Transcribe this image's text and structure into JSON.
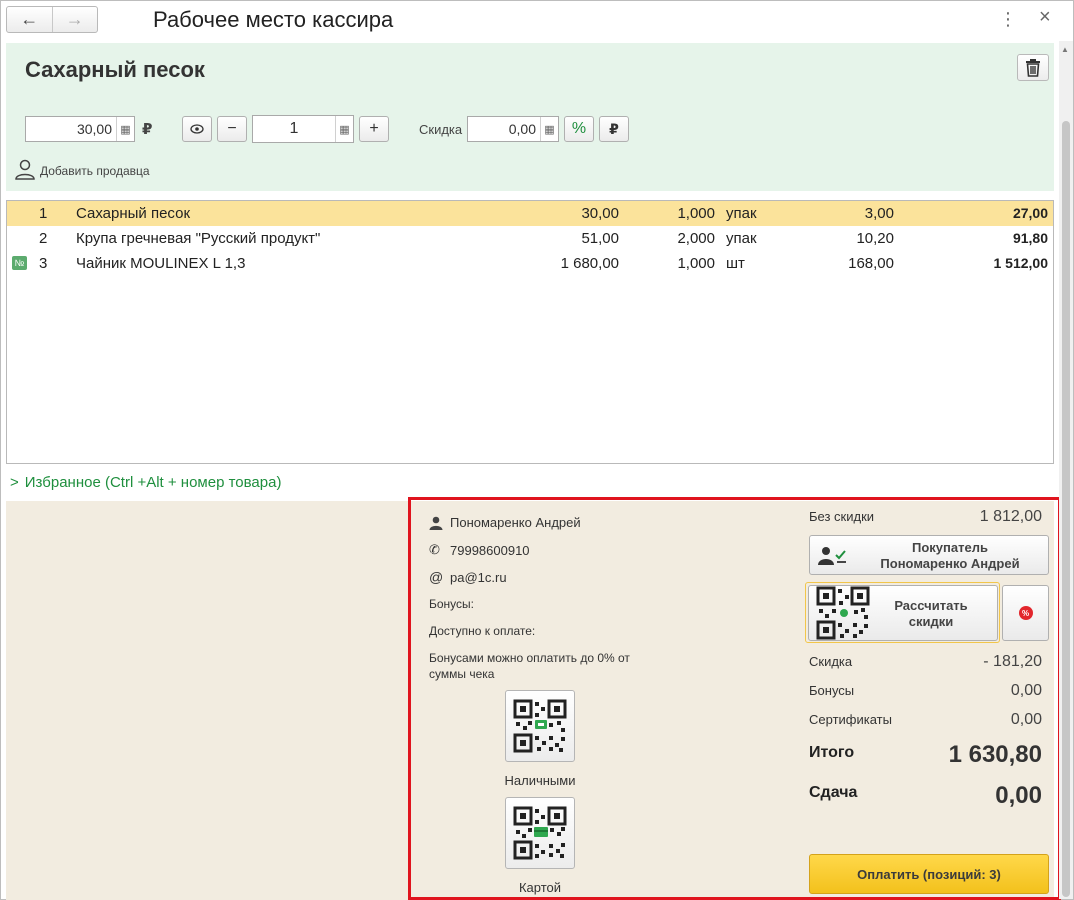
{
  "window": {
    "title": "Рабочее место кассира",
    "back_icon": "←",
    "forward_icon": "→",
    "more_icon": "⋮",
    "close_icon": "×"
  },
  "item": {
    "name": "Сахарный песок",
    "price": "30,00",
    "currency": "₽",
    "quantity": "1",
    "discount_label": "Скидка",
    "discount_value": "0,00",
    "percent_label": "%",
    "ruble_label": "₽",
    "add_seller": "Добавить продавца"
  },
  "table": {
    "rows": [
      {
        "n": "1",
        "name": "Сахарный песок",
        "price": "30,00",
        "qty": "1,000",
        "unit": "упак",
        "discount": "3,00",
        "sum": "27,00"
      },
      {
        "n": "2",
        "name": "Крупа гречневая \"Русский продукт\"",
        "price": "51,00",
        "qty": "2,000",
        "unit": "упак",
        "discount": "10,20",
        "sum": "91,80"
      },
      {
        "n": "3",
        "name": "Чайник MOULINEX L 1,3",
        "price": "1 680,00",
        "qty": "1,000",
        "unit": "шт",
        "discount": "168,00",
        "sum": "1 512,00",
        "marker": "№"
      }
    ]
  },
  "favorites": "Избранное (Ctrl +Alt + номер товара)",
  "customer": {
    "name": "Пономаренко Андрей",
    "phone": "79998600910",
    "email": "pa@1c.ru",
    "bonuses_label": "Бонусы:",
    "available_label": "Доступно к оплате:",
    "bonus_note": "Бонусами можно оплатить до 0% от суммы чека",
    "cash_label": "Наличными",
    "card_label": "Картой"
  },
  "summary": {
    "no_discount_label": "Без скидки",
    "no_discount_value": "1 812,00",
    "buyer_btn_line1": "Покупатель",
    "buyer_btn_line2": "Пономаренко Андрей",
    "calc_btn_line1": "Рассчитать",
    "calc_btn_line2": "скидки",
    "discount_label": "Скидка",
    "discount_value": "- 181,20",
    "bonuses_label": "Бонусы",
    "bonuses_value": "0,00",
    "certificates_label": "Сертификаты",
    "certificates_value": "0,00",
    "total_label": "Итого",
    "total_value": "1 630,80",
    "change_label": "Сдача",
    "change_value": "0,00",
    "pay_label": "Оплатить (позиций: 3)"
  }
}
